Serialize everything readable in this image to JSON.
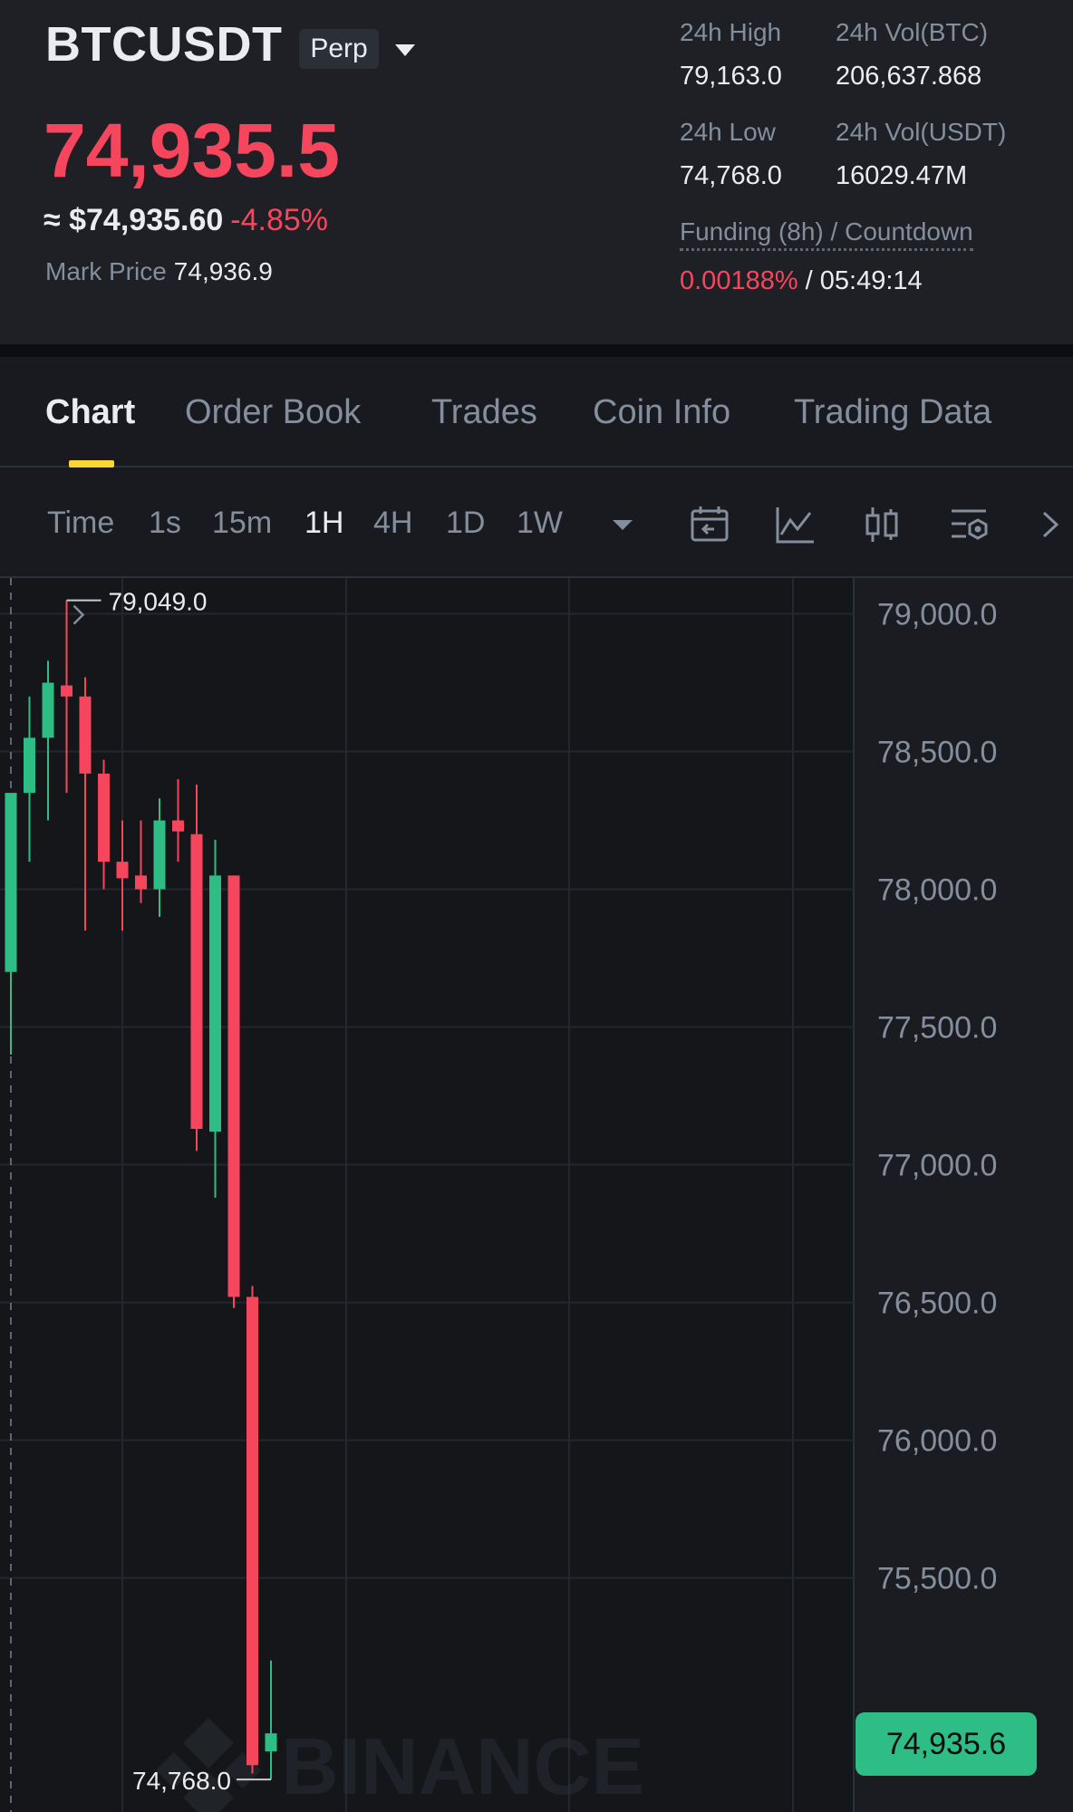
{
  "header": {
    "symbol": "BTCUSDT",
    "badge": "Perp",
    "last_price": "74,935.5",
    "approx_usd": "≈ $74,935.60",
    "change_pct": "-4.85%",
    "mark_price_label": "Mark Price",
    "mark_price_value": "74,936.9",
    "stats": {
      "high_label": "24h High",
      "high_value": "79,163.0",
      "vol_btc_label": "24h Vol(BTC)",
      "vol_btc_value": "206,637.868",
      "low_label": "24h Low",
      "low_value": "74,768.0",
      "vol_usdt_label": "24h Vol(USDT)",
      "vol_usdt_value": "16029.47M",
      "funding_label": "Funding (8h) / Countdown",
      "funding_rate": "0.00188%",
      "funding_sep": " / ",
      "countdown": "05:49:14"
    },
    "colors": {
      "down": "#f6465d",
      "up": "#2ebd85",
      "accent": "#fcd535"
    }
  },
  "tabs": [
    "Chart",
    "Order Book",
    "Trades",
    "Coin Info",
    "Trading Data"
  ],
  "active_tab": "Chart",
  "toolbar": {
    "timeframes": [
      "Time",
      "1s",
      "15m",
      "1H",
      "4H",
      "1D",
      "1W"
    ],
    "active_timeframe": "1H",
    "icons": [
      "dropdown-caret-icon",
      "calendar-icon",
      "indicator-chart-icon",
      "candle-style-icon",
      "settings-icon",
      "chevron-right-icon"
    ]
  },
  "chart_data": {
    "type": "candlestick",
    "y_tick_labels": [
      "79,000.0",
      "78,500.0",
      "78,000.0",
      "77,500.0",
      "77,000.0",
      "76,500.0",
      "76,000.0",
      "75,500.0"
    ],
    "ylim": [
      74650,
      79130
    ],
    "high_marker": "79,049.0",
    "low_marker": "74,768.0",
    "current_price": "74,935.6",
    "watermark": "BINANCE",
    "candles": [
      {
        "o": 77700,
        "h": 78000,
        "l": 77400,
        "c": 78350
      },
      {
        "o": 78350,
        "h": 78700,
        "l": 78100,
        "c": 78550
      },
      {
        "o": 78550,
        "h": 78830,
        "l": 78250,
        "c": 78750
      },
      {
        "o": 78740,
        "h": 79049,
        "l": 78350,
        "c": 78700
      },
      {
        "o": 78700,
        "h": 78770,
        "l": 77850,
        "c": 78420
      },
      {
        "o": 78420,
        "h": 78470,
        "l": 78000,
        "c": 78100
      },
      {
        "o": 78100,
        "h": 78250,
        "l": 77850,
        "c": 78040
      },
      {
        "o": 78050,
        "h": 78250,
        "l": 77950,
        "c": 78000
      },
      {
        "o": 78000,
        "h": 78330,
        "l": 77900,
        "c": 78250
      },
      {
        "o": 78250,
        "h": 78400,
        "l": 78100,
        "c": 78210
      },
      {
        "o": 78200,
        "h": 78380,
        "l": 77050,
        "c": 77130
      },
      {
        "o": 77120,
        "h": 78180,
        "l": 76880,
        "c": 78050
      },
      {
        "o": 78050,
        "h": 78050,
        "l": 76480,
        "c": 76520
      },
      {
        "o": 76520,
        "h": 76560,
        "l": 74790,
        "c": 74820
      },
      {
        "o": 74870,
        "h": 75200,
        "l": 74768,
        "c": 74935.6
      }
    ]
  }
}
